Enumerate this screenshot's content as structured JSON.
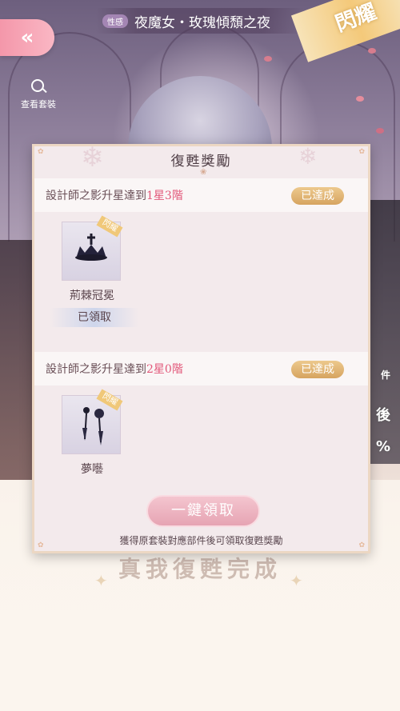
{
  "header": {
    "back_symbol": "«",
    "style_tag": "性感",
    "title": "夜魔女・玫瑰傾頹之夜",
    "flash_badge": "閃耀",
    "view_outfit_label": "查看套裝"
  },
  "background": {
    "right_text_top": "件",
    "right_text_mid": "後",
    "right_text_bot": "%",
    "slogan": "真我復甦完成"
  },
  "modal": {
    "title": "復甦獎勵",
    "rewards": [
      {
        "condition_prefix": "設計師之影升星達到",
        "condition_highlight": "1星3階",
        "status": "已達成",
        "item_name": "荊棘冠冕",
        "item_badge": "閃耀",
        "item_icon": "crown-icon",
        "claimed_label": "已領取"
      },
      {
        "condition_prefix": "設計師之影升星達到",
        "condition_highlight": "2星0階",
        "status": "已達成",
        "item_name": "夢囈",
        "item_badge": "閃耀",
        "item_icon": "earring-icon"
      }
    ],
    "claim_all_label": "一鍵領取",
    "hint": "獲得原套裝對應部件後可領取復甦獎勵"
  },
  "colors": {
    "accent_pink": "#e2587a",
    "badge_gold": "#d6a460",
    "back_button": "#f497aa"
  }
}
